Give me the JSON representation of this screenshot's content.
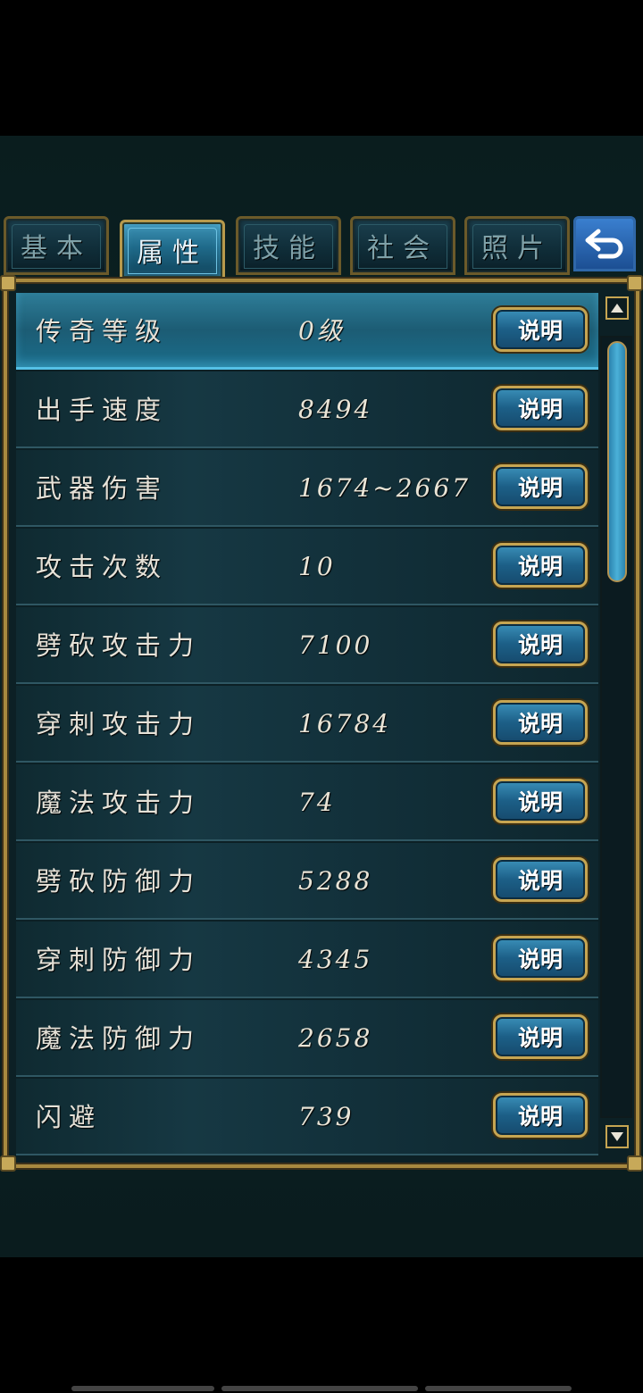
{
  "tabs": [
    {
      "label": "基本",
      "active": false
    },
    {
      "label": "属性",
      "active": true
    },
    {
      "label": "技能",
      "active": false
    },
    {
      "label": "社会",
      "active": false
    },
    {
      "label": "照片",
      "active": false
    }
  ],
  "back_icon": "back-arrow-icon",
  "attributes": [
    {
      "label": "传奇等级",
      "value": "0级",
      "button": "说明",
      "selected": true
    },
    {
      "label": "出手速度",
      "value": "8494",
      "button": "说明",
      "selected": false
    },
    {
      "label": "武器伤害",
      "value": "1674~2667",
      "button": "说明",
      "selected": false
    },
    {
      "label": "攻击次数",
      "value": "10",
      "button": "说明",
      "selected": false
    },
    {
      "label": "劈砍攻击力",
      "value": "7100",
      "button": "说明",
      "selected": false
    },
    {
      "label": "穿刺攻击力",
      "value": "16784",
      "button": "说明",
      "selected": false
    },
    {
      "label": "魔法攻击力",
      "value": "74",
      "button": "说明",
      "selected": false
    },
    {
      "label": "劈砍防御力",
      "value": "5288",
      "button": "说明",
      "selected": false
    },
    {
      "label": "穿刺防御力",
      "value": "4345",
      "button": "说明",
      "selected": false
    },
    {
      "label": "魔法防御力",
      "value": "2658",
      "button": "说明",
      "selected": false
    },
    {
      "label": "闪避",
      "value": "739",
      "button": "说明",
      "selected": false
    }
  ],
  "colors": {
    "gold_border": "#a8893f",
    "active_tab": "#3f95b8",
    "selected_row": "#2e7d98",
    "button_blue": "#1c5f87"
  }
}
